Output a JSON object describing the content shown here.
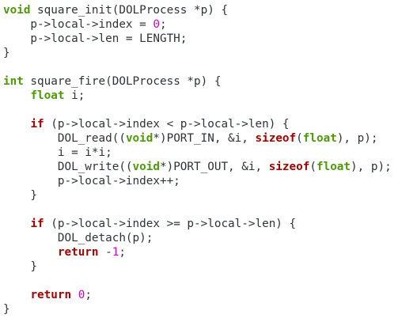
{
  "colors": {
    "background": "#ffffff",
    "text": "#2e3436",
    "keyword": "#a40000",
    "type": "#4e9a06",
    "number": "#cc00cc"
  },
  "code": {
    "language": "c",
    "lines": [
      [
        [
          "type",
          "void"
        ],
        [
          "text",
          " square_init(DOLProcess *p) {"
        ]
      ],
      [
        [
          "text",
          "    p->local->index = "
        ],
        [
          "num",
          "0"
        ],
        [
          "text",
          ";"
        ]
      ],
      [
        [
          "text",
          "    p->local->len = LENGTH;"
        ]
      ],
      [
        [
          "text",
          "}"
        ]
      ],
      [],
      [
        [
          "type",
          "int"
        ],
        [
          "text",
          " square_fire(DOLProcess *p) {"
        ]
      ],
      [
        [
          "text",
          "    "
        ],
        [
          "type",
          "float"
        ],
        [
          "text",
          " i;"
        ]
      ],
      [],
      [
        [
          "text",
          "    "
        ],
        [
          "kw",
          "if"
        ],
        [
          "text",
          " (p->local->index < p->local->len) {"
        ]
      ],
      [
        [
          "text",
          "        DOL_read(("
        ],
        [
          "type",
          "void"
        ],
        [
          "text",
          "*)PORT_IN, &i, "
        ],
        [
          "kw",
          "sizeof"
        ],
        [
          "text",
          "("
        ],
        [
          "type",
          "float"
        ],
        [
          "text",
          "), p);"
        ]
      ],
      [
        [
          "text",
          "        i = i*i;"
        ]
      ],
      [
        [
          "text",
          "        DOL_write(("
        ],
        [
          "type",
          "void"
        ],
        [
          "text",
          "*)PORT_OUT, &i, "
        ],
        [
          "kw",
          "sizeof"
        ],
        [
          "text",
          "("
        ],
        [
          "type",
          "float"
        ],
        [
          "text",
          "), p);"
        ]
      ],
      [
        [
          "text",
          "        p->local->index++;"
        ]
      ],
      [
        [
          "text",
          "    }"
        ]
      ],
      [],
      [
        [
          "text",
          "    "
        ],
        [
          "kw",
          "if"
        ],
        [
          "text",
          " (p->local->index >= p->local->len) {"
        ]
      ],
      [
        [
          "text",
          "        DOL_detach(p);"
        ]
      ],
      [
        [
          "text",
          "        "
        ],
        [
          "kw",
          "return"
        ],
        [
          "text",
          " -"
        ],
        [
          "num",
          "1"
        ],
        [
          "text",
          ";"
        ]
      ],
      [
        [
          "text",
          "    }"
        ]
      ],
      [],
      [
        [
          "text",
          "    "
        ],
        [
          "kw",
          "return"
        ],
        [
          "text",
          " "
        ],
        [
          "num",
          "0"
        ],
        [
          "text",
          ";"
        ]
      ],
      [
        [
          "text",
          "}"
        ]
      ]
    ]
  }
}
